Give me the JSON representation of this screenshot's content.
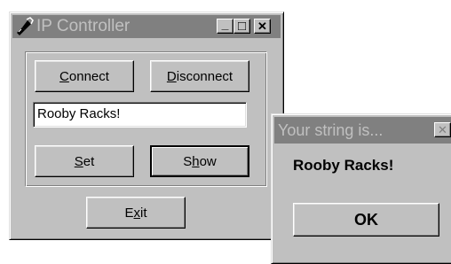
{
  "main_window": {
    "title": "IP Controller",
    "app_icon": "plug-icon",
    "minimize_glyph": "_",
    "maximize_glyph": "□",
    "close_glyph": "✕",
    "connect_label": {
      "pre": "",
      "u": "C",
      "post": "onnect"
    },
    "disconnect_label": {
      "pre": "",
      "u": "D",
      "post": "isconnect"
    },
    "text_value": "Rooby Racks!",
    "set_label": {
      "pre": "",
      "u": "S",
      "post": "et"
    },
    "show_label": {
      "pre": "S",
      "u": "h",
      "post": "ow"
    },
    "exit_label": {
      "pre": "E",
      "u": "x",
      "post": "it"
    }
  },
  "dialog": {
    "title": "Your string is...",
    "close_glyph": "✕",
    "message": "Rooby Racks!",
    "ok_label": "OK"
  }
}
